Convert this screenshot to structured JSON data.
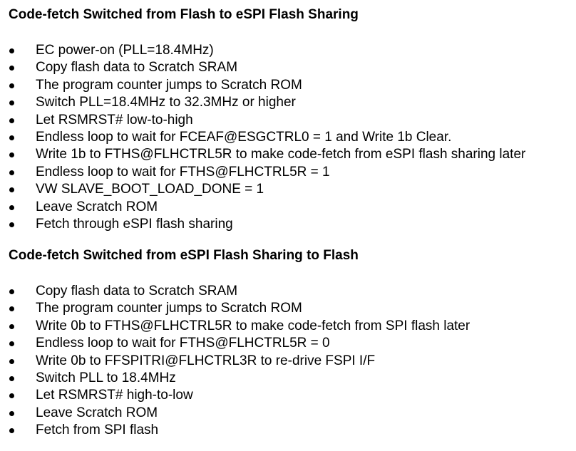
{
  "sections": [
    {
      "heading": "Code-fetch Switched from Flash to eSPI Flash Sharing",
      "items": [
        "EC power-on (PLL=18.4MHz)",
        "Copy flash data to Scratch SRAM",
        "The program counter jumps to Scratch ROM",
        "Switch PLL=18.4MHz to 32.3MHz or higher",
        "Let RSMRST# low-to-high",
        "Endless loop to wait for FCEAF@ESGCTRL0 = 1 and Write 1b Clear.",
        "Write 1b to FTHS@FLHCTRL5R to make code-fetch from eSPI flash sharing later",
        "Endless loop to wait for FTHS@FLHCTRL5R = 1",
        "VW SLAVE_BOOT_LOAD_DONE = 1",
        "Leave Scratch ROM",
        "Fetch through eSPI flash sharing"
      ]
    },
    {
      "heading": "Code-fetch Switched from eSPI Flash Sharing to Flash",
      "items": [
        "Copy flash data to Scratch SRAM",
        "The program counter jumps to Scratch ROM",
        "Write 0b to FTHS@FLHCTRL5R to make code-fetch from SPI flash later",
        "Endless loop to wait for FTHS@FLHCTRL5R = 0",
        "Write 0b to FFSPITRI@FLHCTRL3R to re-drive FSPI I/F",
        "Switch PLL to 18.4MHz",
        "Let RSMRST# high-to-low",
        "Leave Scratch ROM",
        "Fetch from SPI flash"
      ]
    }
  ]
}
